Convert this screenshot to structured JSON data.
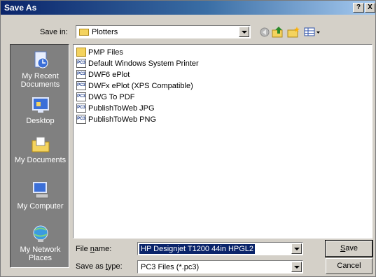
{
  "window": {
    "title": "Save As",
    "help_label": "?",
    "close_label": "X"
  },
  "toolbar": {
    "save_in_label": "Save in:",
    "save_in_value": "Plotters"
  },
  "places": [
    {
      "label": "My Recent Documents",
      "icon": "recent-documents-icon"
    },
    {
      "label": "Desktop",
      "icon": "desktop-icon"
    },
    {
      "label": "My Documents",
      "icon": "my-documents-icon"
    },
    {
      "label": "My Computer",
      "icon": "my-computer-icon"
    },
    {
      "label": "My Network Places",
      "icon": "network-places-icon"
    }
  ],
  "files": [
    {
      "name": "PMP Files",
      "type": "folder"
    },
    {
      "name": "Default Windows System Printer",
      "type": "pc3"
    },
    {
      "name": "DWF6 ePlot",
      "type": "pc3"
    },
    {
      "name": "DWFx ePlot (XPS Compatible)",
      "type": "pc3"
    },
    {
      "name": "DWG To PDF",
      "type": "pc3"
    },
    {
      "name": "PublishToWeb JPG",
      "type": "pc3"
    },
    {
      "name": "PublishToWeb PNG",
      "type": "pc3"
    }
  ],
  "form": {
    "file_name_label_pre": "File ",
    "file_name_label_key": "n",
    "file_name_label_post": "ame:",
    "file_name_value": "HP Designjet T1200 44in HPGL2",
    "save_as_type_label_pre": "Save as ",
    "save_as_type_label_key": "t",
    "save_as_type_label_post": "ype:",
    "save_as_type_value": "PC3 Files (*.pc3)"
  },
  "buttons": {
    "save_key": "S",
    "save_rest": "ave",
    "cancel_label": "Cancel"
  },
  "pc3_icon_text": "PC3"
}
